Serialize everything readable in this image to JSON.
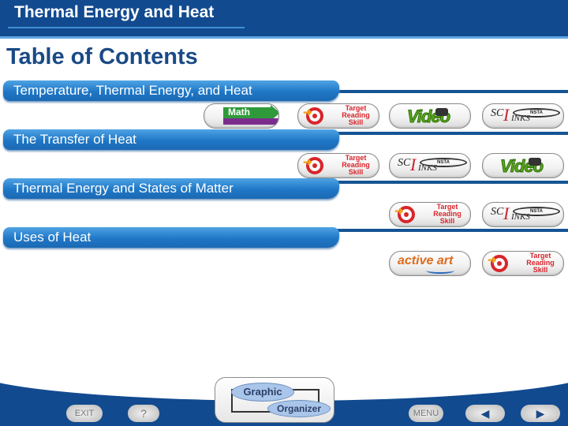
{
  "header": {
    "title": "Thermal Energy and Heat"
  },
  "page_title": "Table of Contents",
  "sections": [
    {
      "label": "Temperature, Thermal Energy, and Heat",
      "resources": [
        "Math",
        "Target Reading Skill",
        "Video",
        "SciLinks"
      ]
    },
    {
      "label": "The Transfer of Heat",
      "resources": [
        "Target Reading Skill",
        "SciLinks",
        "Video"
      ]
    },
    {
      "label": "Thermal Energy and States of Matter",
      "resources": [
        "Target Reading Skill",
        "SciLinks"
      ]
    },
    {
      "label": "Uses of Heat",
      "resources": [
        "active art",
        "Target Reading Skill"
      ]
    }
  ],
  "buttons": {
    "math": "Math",
    "target": {
      "line1": "Target",
      "line2": "Reading",
      "line3": "Skill"
    },
    "video": "Video",
    "scilinks": {
      "sci": "SC",
      "l": "I",
      "inks": "INKS",
      "nsta": "NSTA"
    },
    "active_art": "active art"
  },
  "footer": {
    "exit": "EXIT",
    "help": "?",
    "graphic_organizer": {
      "line1": "Graphic",
      "line2": "Organizer"
    },
    "menu": "MENU",
    "prev": "◀",
    "next": "▶"
  }
}
